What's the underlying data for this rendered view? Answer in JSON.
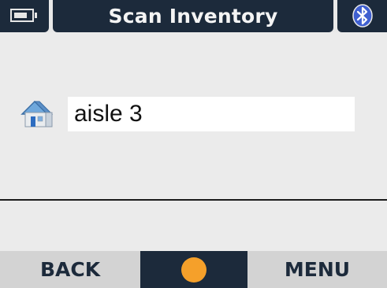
{
  "titlebar": {
    "title": "Scan Inventory",
    "battery_icon": "battery-icon",
    "bluetooth_icon": "bluetooth-icon"
  },
  "content": {
    "location_icon": "home-icon",
    "location_value": "aisle 3"
  },
  "softkeys": {
    "left_label": "BACK",
    "right_label": "MENU",
    "center_indicator_color": "#f5a02a"
  },
  "colors": {
    "titlebar_bg": "#1c2a3b",
    "screen_bg": "#ebebeb",
    "softkey_bg": "#d3d3d3"
  }
}
